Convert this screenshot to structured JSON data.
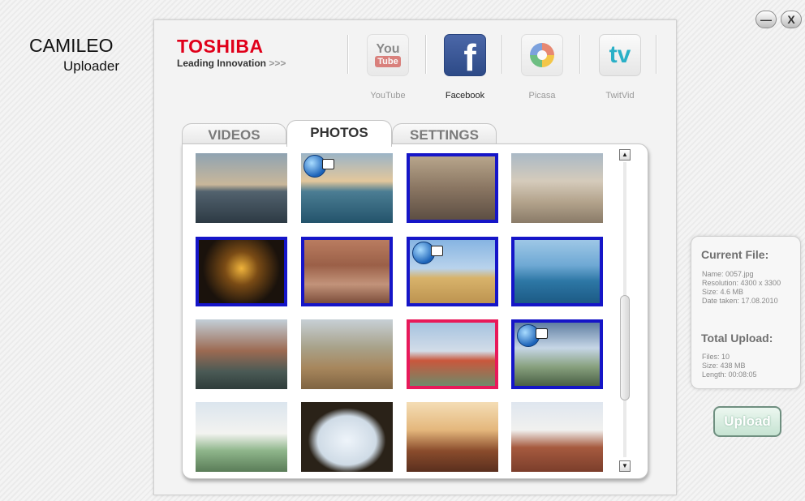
{
  "window": {
    "minimize_label": "—",
    "close_label": "X"
  },
  "app": {
    "title": "CAMILEO",
    "subtitle": "Uploader"
  },
  "brand": {
    "name": "TOSHIBA",
    "tagline": "Leading Innovation",
    "tagline_arrows": ">>>"
  },
  "services": [
    {
      "label": "YouTube",
      "icon": "youtube-icon",
      "icon_text_top": "You",
      "icon_text_bottom": "Tube",
      "active": false
    },
    {
      "label": "Facebook",
      "icon": "facebook-icon",
      "icon_text": "f",
      "active": true
    },
    {
      "label": "Picasa",
      "icon": "picasa-icon",
      "active": false
    },
    {
      "label": "TwitVid",
      "icon": "twitvid-icon",
      "icon_text": "tv",
      "active": false
    }
  ],
  "tabs": [
    {
      "label": "VIDEOS",
      "active": false
    },
    {
      "label": "PHOTOS",
      "active": true
    },
    {
      "label": "SETTINGS",
      "active": false
    }
  ],
  "photos": [
    {
      "subject": "sailing-ship",
      "selected": "none",
      "uploaded": false
    },
    {
      "subject": "sea-coast",
      "selected": "none",
      "uploaded": true
    },
    {
      "subject": "colosseum",
      "selected": "blue",
      "uploaded": false
    },
    {
      "subject": "st-peters-square",
      "selected": "none",
      "uploaded": false
    },
    {
      "subject": "eiffel-tower-night",
      "selected": "blue",
      "uploaded": false
    },
    {
      "subject": "desert-canyon",
      "selected": "blue",
      "uploaded": false
    },
    {
      "subject": "pyramids",
      "selected": "blue",
      "uploaded": true
    },
    {
      "subject": "sydney-opera-house",
      "selected": "blue",
      "uploaded": false
    },
    {
      "subject": "venice-canal",
      "selected": "none",
      "uploaded": false
    },
    {
      "subject": "zebra-savanna",
      "selected": "none",
      "uploaded": false
    },
    {
      "subject": "golden-gate-bridge",
      "selected": "red",
      "uploaded": false
    },
    {
      "subject": "city-view",
      "selected": "blue",
      "uploaded": true
    },
    {
      "subject": "taj-mahal-day",
      "selected": "none",
      "uploaded": false
    },
    {
      "subject": "taj-mahal-arch",
      "selected": "none",
      "uploaded": false
    },
    {
      "subject": "jama-masjid-sunset",
      "selected": "none",
      "uploaded": false
    },
    {
      "subject": "red-mosque",
      "selected": "none",
      "uploaded": false
    }
  ],
  "current_file": {
    "heading": "Current File:",
    "name": "Name: 0057.jpg",
    "resolution": "Resolution: 4300 x 3300",
    "size": "Size: 4.6 MB",
    "date": "Date taken: 17.08.2010"
  },
  "total_upload": {
    "heading": "Total Upload:",
    "files": "Files: 10",
    "size": "Size: 438 MB",
    "length": "Length: 00:08:05"
  },
  "upload_button": {
    "label": "Upload",
    "enabled": false
  },
  "colors": {
    "selected_blue": "#1515c8",
    "selected_red": "#e8195a",
    "brand_red": "#e0001a"
  }
}
